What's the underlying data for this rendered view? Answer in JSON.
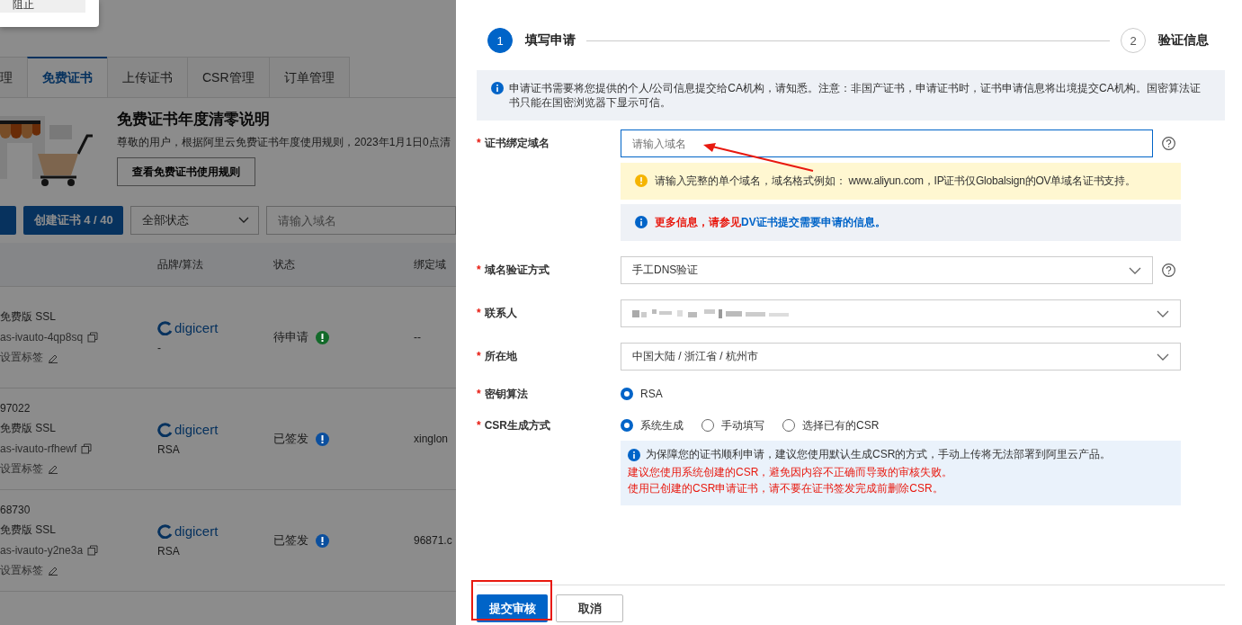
{
  "popup": {
    "items": [
      {
        "label": "阻止"
      }
    ]
  },
  "tabs": [
    {
      "label": "理",
      "selected": false
    },
    {
      "label": "免费证书",
      "selected": true
    },
    {
      "label": "上传证书",
      "selected": false
    },
    {
      "label": "CSR管理",
      "selected": false
    },
    {
      "label": "订单管理",
      "selected": false
    }
  ],
  "banner": {
    "title": "免费证书年度清零说明",
    "description": "尊敬的用户，根据阿里云免费证书年度使用规则，2023年1月1日0点清",
    "button": "查看免费证书使用规则"
  },
  "toolbar": {
    "create_button": "创建证书 4 / 40",
    "status_filter": {
      "value": "全部状态"
    },
    "search": {
      "placeholder": "请输入域名"
    }
  },
  "table": {
    "columns": [
      "品牌/算法",
      "状态",
      "绑定域"
    ],
    "rows": [
      {
        "id": "",
        "product": "免费版 SSL",
        "name": "as-ivauto-4qp8sq",
        "tag": "设置标签",
        "brand": "digicert",
        "algorithm": "-",
        "status": "待申请",
        "color": "#136a2a",
        "domain": "--"
      },
      {
        "id": "97022",
        "product": "免费版 SSL",
        "name": "as-ivauto-rfhewf",
        "tag": "设置标签",
        "brand": "digicert",
        "algorithm": "RSA",
        "status": "已签发",
        "color": "#0b4f9e",
        "domain": "xinglon"
      },
      {
        "id": "68730",
        "product": "免费版 SSL",
        "name": "as-ivauto-y2ne3a",
        "tag": "设置标签",
        "brand": "digicert",
        "algorithm": "RSA",
        "status": "已签发",
        "color": "#0b4f9e",
        "domain": "96871.c"
      }
    ]
  },
  "drawer": {
    "steps": [
      {
        "number": "1",
        "label": "填写申请",
        "selected": true
      },
      {
        "number": "2",
        "label": "验证信息",
        "selected": false
      }
    ],
    "notice": "申请证书需要将您提供的个人/公司信息提交给CA机构，请知悉。注意：非国产证书，申请证书时，证书申请信息将出境提交CA机构。国密算法证书只能在国密浏览器下显示可信。",
    "fields": [
      {
        "kind": "input",
        "mark": "*",
        "label": "证书绑定域名",
        "placeholder": "请输入域名",
        "help": true,
        "warning": "请输入完整的单个域名，域名格式例如： www.aliyun.com，IP证书仅Globalsign的OV单域名证书支持。",
        "info": {
          "text": "更多信息，请参见",
          "link": "DV证书提交需要申请的信息。"
        }
      },
      {
        "kind": "select",
        "mark": "*",
        "label": "域名验证方式",
        "value": "手工DNS验证",
        "help": true
      },
      {
        "kind": "select",
        "mark": "*",
        "label": "联系人",
        "blurred": true,
        "help": false
      },
      {
        "kind": "select",
        "mark": "*",
        "label": "所在地",
        "value": "中国大陆 / 浙江省 / 杭州市",
        "help": false
      },
      {
        "kind": "radio",
        "mark": "*",
        "label": "密钥算法",
        "options": [
          {
            "label": "RSA",
            "selected": true
          }
        ]
      },
      {
        "kind": "radio",
        "mark": "*",
        "label": "CSR生成方式",
        "options": [
          {
            "label": "系统生成",
            "selected": true
          },
          {
            "label": "手动填写",
            "selected": false
          },
          {
            "label": "选择已有的CSR",
            "selected": false
          }
        ],
        "note": {
          "text": "为保障您的证书顺利申请，建议您使用默认生成CSR的方式，手动上传将无法部署到阿里云产品。",
          "warnings": [
            "建议您使用系统创建的CSR，避免因内容不正确而导致的审核失败。",
            "使用已创建的CSR申请证书，请不要在证书签发完成前删除CSR。"
          ]
        }
      }
    ],
    "actions": [
      {
        "label": "提交审核",
        "kind": "primary"
      },
      {
        "label": "取消",
        "kind": "default"
      }
    ]
  }
}
